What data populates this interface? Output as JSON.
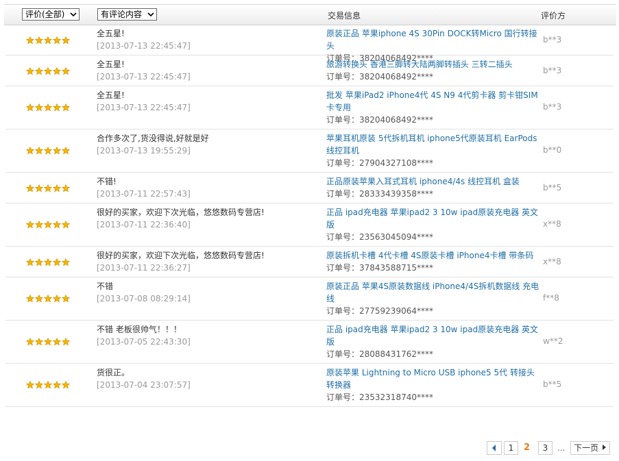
{
  "header": {
    "filter_rating": "评价(全部)",
    "filter_content": "有评论内容",
    "col_info": "交易信息",
    "col_rater": "评价方"
  },
  "colors": {
    "link": "#1f6ea4",
    "star": "#f7b500",
    "current_page": "#e67e22"
  },
  "reviews": [
    {
      "stars": 5,
      "comment": "全五星!",
      "date": "[2013-07-13 22:45:47]",
      "item": "原装正品 苹果iphone 4S 30Pin DOCK转Micro 国行转接头",
      "order": "订单号：38204068492****",
      "rater": "b**3"
    },
    {
      "stars": 5,
      "comment": "全五星!",
      "date": "[2013-07-13 22:45:47]",
      "item": "旅游转换头 香港三脚转大陆两脚转插头 三转二插头",
      "order": "订单号：38204068492****",
      "rater": "b**3"
    },
    {
      "stars": 5,
      "comment": "全五星!",
      "date": "[2013-07-13 22:45:47]",
      "item": "批发 苹果iPad2 iPhone4代 4S N9 4代剪卡器 剪卡钳SIM卡专用",
      "order": "订单号：38204068492****",
      "rater": "b**3"
    },
    {
      "stars": 5,
      "comment": "合作多次了,货没得说,好就是好",
      "date": "[2013-07-13 19:55:29]",
      "item": "苹果耳机原装 5代拆机耳机 iphone5代原装耳机 EarPods线控耳机",
      "order": "订单号：27904327108****",
      "rater": "b**0"
    },
    {
      "stars": 5,
      "comment": "不错!",
      "date": "[2013-07-11 22:57:43]",
      "item": "正品原装苹果入耳式耳机 iphone4/4s 线控耳机 盒装",
      "order": "订单号：28333439358****",
      "rater": "b**5"
    },
    {
      "stars": 5,
      "comment": "很好的买家，欢迎下次光临，悠悠数码专营店!",
      "date": "[2013-07-11 22:36:40]",
      "item": "正品 ipad充电器 苹果ipad2 3 10w ipad原装充电器 英文版",
      "order": "订单号：23563045094****",
      "rater": "x**8"
    },
    {
      "stars": 5,
      "comment": "很好的买家，欢迎下次光临，悠悠数码专营店!",
      "date": "[2013-07-11 22:36:27]",
      "item": "原装拆机卡槽 4代卡槽 4S原装卡槽 iPhone4卡槽 带条码",
      "order": "订单号：37843588715****",
      "rater": "x**8"
    },
    {
      "stars": 5,
      "comment": "不错",
      "date": "[2013-07-08 08:29:14]",
      "item": "原装正品 苹果4S原装数据线 iPhone4/4S拆机数据线 充电线",
      "order": "订单号：27759239064****",
      "rater": "f**8"
    },
    {
      "stars": 5,
      "comment": "不错 老板很帅气！！！",
      "date": "[2013-07-05 22:43:30]",
      "item": "正品 ipad充电器 苹果ipad2 3 10w ipad原装充电器 英文版",
      "order": "订单号：28088431762****",
      "rater": "w**2"
    },
    {
      "stars": 5,
      "comment": "货很正。",
      "date": "[2013-07-04 23:07:57]",
      "item": "原装苹果 Lightning to Micro USB iphone5 5代 转接头 转换器",
      "order": "订单号：23532318740****",
      "rater": "b**5"
    }
  ],
  "pagination": {
    "prev_icon": "chevron-left-icon",
    "pages": [
      "1",
      "2",
      "3"
    ],
    "current": "2",
    "ellipsis": "...",
    "next_label": "下一页"
  }
}
